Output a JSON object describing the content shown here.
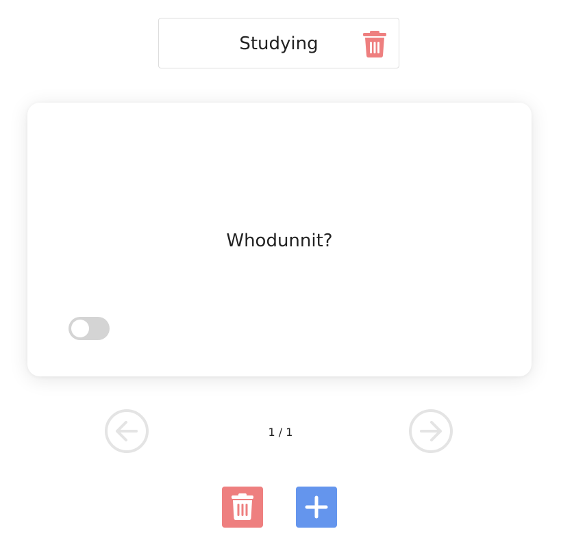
{
  "deck": {
    "title": "Studying",
    "delete_icon": "trash-icon",
    "delete_color": "#ee7f7f"
  },
  "card": {
    "text": "Whodunnit?",
    "toggle_on": false,
    "toggle_color": "#d4d4d4"
  },
  "navigation": {
    "counter": "1 / 1",
    "prev_icon": "arrow-left-icon",
    "next_icon": "arrow-right-icon",
    "disabled_color": "#e4e4e4"
  },
  "actions": {
    "delete_icon": "trash-icon",
    "delete_color": "#ee7f7f",
    "add_icon": "plus-icon",
    "add_color": "#6495ed"
  }
}
